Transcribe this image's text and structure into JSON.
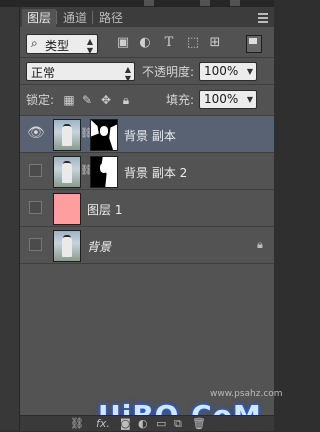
{
  "tabs": [
    "图层",
    "通道",
    "路径"
  ],
  "filter": {
    "label": "类型",
    "icons": [
      "image-filter-icon",
      "adjustment-filter-icon",
      "text-filter-icon",
      "shape-filter-icon",
      "smart-object-filter-icon"
    ]
  },
  "blend_mode": "正常",
  "opacity": {
    "label": "不透明度:",
    "value": "100%"
  },
  "lock": {
    "label": "锁定:"
  },
  "fill": {
    "label": "填充:",
    "value": "100%"
  },
  "layers": [
    {
      "name": "背景 副本",
      "selected": true,
      "visible": true,
      "has_mask": true,
      "thumb": "photo",
      "italic": false,
      "locked": false
    },
    {
      "name": "背景 副本 2",
      "selected": false,
      "visible": false,
      "has_mask": true,
      "thumb": "photo",
      "italic": false,
      "locked": false
    },
    {
      "name": "图层 1",
      "selected": false,
      "visible": false,
      "has_mask": false,
      "thumb": "pink",
      "italic": false,
      "locked": false
    },
    {
      "name": "背景",
      "selected": false,
      "visible": false,
      "has_mask": false,
      "thumb": "photo",
      "italic": true,
      "locked": true
    }
  ],
  "footer": {
    "fx": "fx."
  },
  "watermark": {
    "main": "UiBQ.CoM",
    "small": "www.psahz.com"
  },
  "colors": {
    "panel": "#535353",
    "selected_layer": "#586273",
    "pink_layer": "#ff9e9e"
  }
}
